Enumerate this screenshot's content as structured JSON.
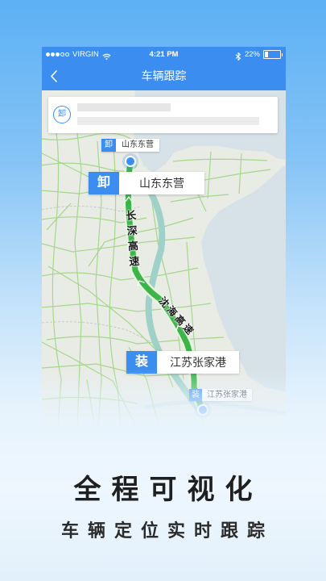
{
  "status_bar": {
    "signal": {
      "filled": 3,
      "total": 5
    },
    "carrier": "VIRGIN",
    "time": "4:21 PM",
    "battery": "22%"
  },
  "nav": {
    "title": "车辆跟踪"
  },
  "info_card": {
    "badge": "卸"
  },
  "map": {
    "origin_tag": {
      "badge": "卸",
      "name": "山东东营"
    },
    "origin_label": {
      "badge": "卸",
      "name": "山东东营"
    },
    "roads": [
      "长深高速",
      "沈海高速"
    ],
    "destination_label": {
      "badge": "装",
      "name": "江苏张家港"
    },
    "destination_tag": {
      "badge": "装",
      "name": "江苏张家港"
    }
  },
  "headline": "全程可视化",
  "subheadline": "车辆定位实时跟踪",
  "icons": {
    "back": "chevron-left-icon",
    "signal": "signal-strength-icon",
    "wifi": "wifi-icon",
    "bluetooth": "bluetooth-icon",
    "battery": "battery-icon",
    "card_pin": "location-pin-icon",
    "marker": "location-dot-icon",
    "route_arrow": "route-arrow-icon"
  },
  "colors": {
    "primary": "#3b8ef0",
    "route": "#3cb44a",
    "highway": "#9fd1c8",
    "land": "#e9ebe5",
    "sea": "#d6e2e8"
  }
}
